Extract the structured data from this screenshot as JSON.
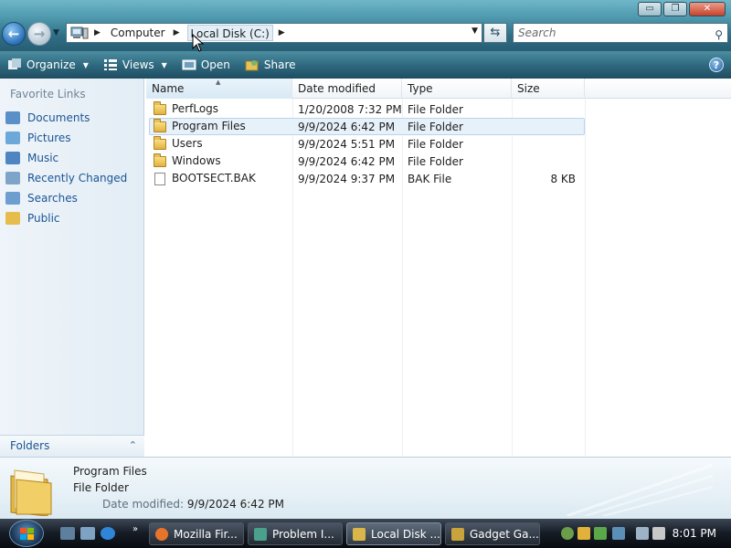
{
  "window": {
    "minimize_glyph": "▭",
    "maximize_glyph": "❐",
    "close_glyph": "✕"
  },
  "address": {
    "crumbs": [
      "Computer",
      "Local Disk (C:)"
    ],
    "search_placeholder": "Search"
  },
  "toolbar": {
    "organize": "Organize",
    "views": "Views",
    "open": "Open",
    "share": "Share",
    "help": "?"
  },
  "sidebar": {
    "title": "Favorite Links",
    "items": [
      {
        "label": "Documents",
        "icon": "documents-icon",
        "color": "#5b8fc8"
      },
      {
        "label": "Pictures",
        "icon": "pictures-icon",
        "color": "#6da9d8"
      },
      {
        "label": "Music",
        "icon": "music-icon",
        "color": "#4f86c2"
      },
      {
        "label": "Recently Changed",
        "icon": "recently-changed-icon",
        "color": "#7fa4c9"
      },
      {
        "label": "Searches",
        "icon": "searches-icon",
        "color": "#6c9ecf"
      },
      {
        "label": "Public",
        "icon": "public-folder-icon",
        "color": "#e6bd4c"
      }
    ],
    "folders_label": "Folders"
  },
  "columns": {
    "name": "Name",
    "date": "Date modified",
    "type": "Type",
    "size": "Size"
  },
  "files": [
    {
      "name": "PerfLogs",
      "date": "1/20/2008 7:32 PM",
      "type": "File Folder",
      "size": "",
      "kind": "folder"
    },
    {
      "name": "Program Files",
      "date": "9/9/2024 6:42 PM",
      "type": "File Folder",
      "size": "",
      "kind": "folder"
    },
    {
      "name": "Users",
      "date": "9/9/2024 5:51 PM",
      "type": "File Folder",
      "size": "",
      "kind": "folder"
    },
    {
      "name": "Windows",
      "date": "9/9/2024 6:42 PM",
      "type": "File Folder",
      "size": "",
      "kind": "folder"
    },
    {
      "name": "BOOTSECT.BAK",
      "date": "9/9/2024 9:37 PM",
      "type": "BAK File",
      "size": "8 KB",
      "kind": "file"
    }
  ],
  "details": {
    "name": "Program Files",
    "type": "File Folder",
    "date_label": "Date modified:",
    "date_value": "9/9/2024 6:42 PM"
  },
  "taskbar": {
    "tasks": [
      {
        "label": "Mozilla Fir...",
        "icon": "firefox-icon",
        "color": "#e8742a"
      },
      {
        "label": "Problem I...",
        "icon": "problem-reports-icon",
        "color": "#4aa08a"
      },
      {
        "label": "Local Disk ...",
        "icon": "explorer-icon",
        "color": "#d9b54a"
      },
      {
        "label": "Gadget Ga...",
        "icon": "gadget-icon",
        "color": "#c9a43c"
      }
    ],
    "quick_launch_more": "»",
    "clock": "8:01 PM"
  }
}
